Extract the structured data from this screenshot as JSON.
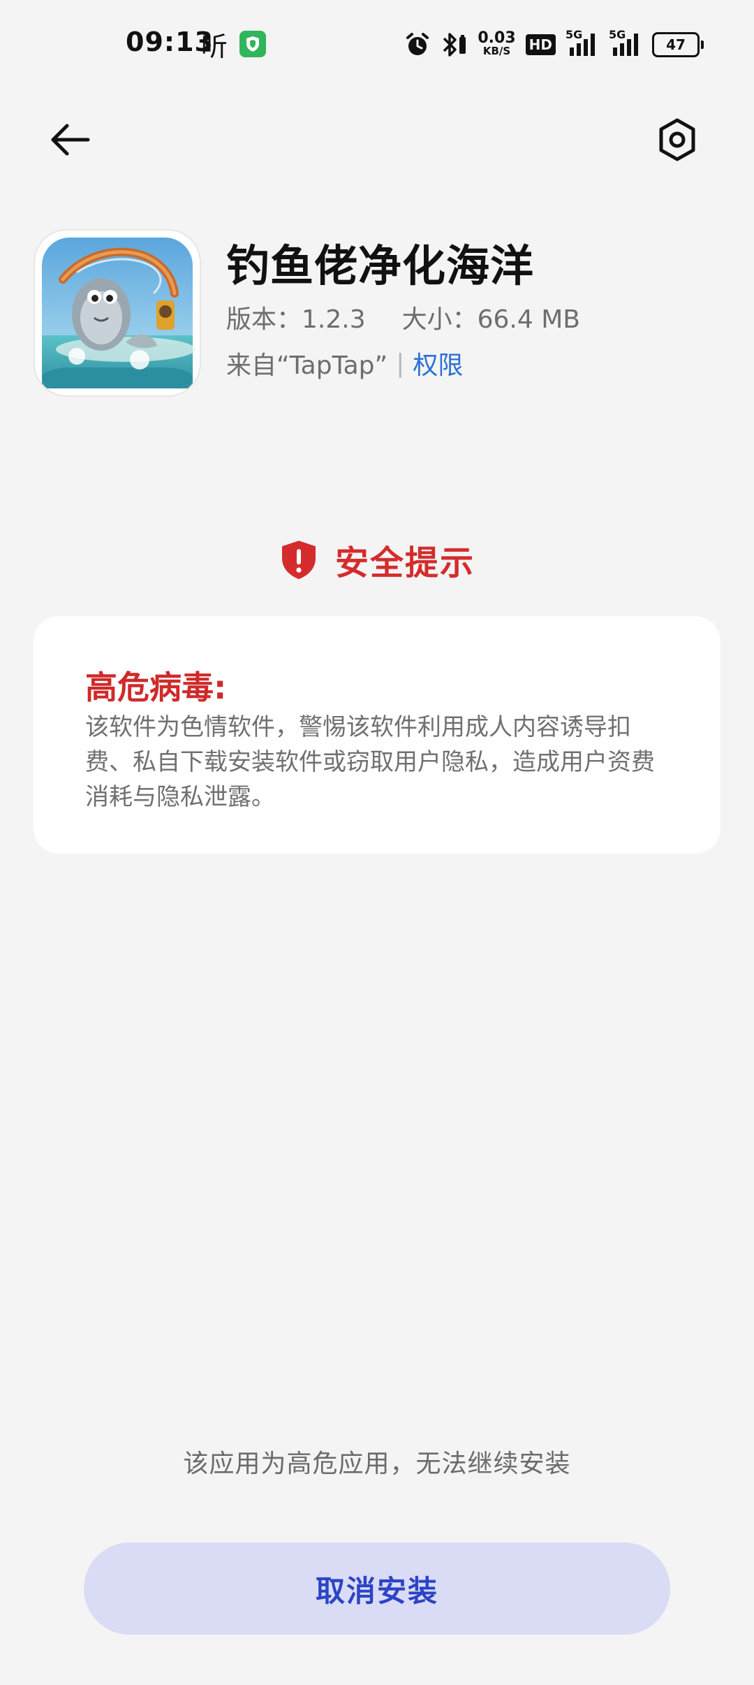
{
  "status_bar": {
    "time": "09:13",
    "ting_icon": "ting-listen-icon",
    "shield_app_icon": "green-shield-icon",
    "net_speed_value": "0.03",
    "net_speed_unit": "KB/S",
    "hd_label": "HD",
    "network_1": "5G",
    "network_2": "5G",
    "battery_level": "47"
  },
  "header": {
    "back_icon": "back-arrow-icon",
    "settings_icon": "settings-hexagon-icon"
  },
  "app": {
    "name": "钓鱼佬净化海洋",
    "version": "版本：1.2.3",
    "size": "大小：66.4 MB",
    "source": "来自“TapTap”",
    "separator": "|",
    "permissions_link": "权限"
  },
  "security": {
    "title": "安全提示",
    "icon": "red-shield-alert-icon",
    "warning_heading": "高危病毒:",
    "warning_body": "该软件为色情软件，警惕该软件利用成人内容诱导扣费、私自下载安装软件或窃取用户隐私，造成用户资费消耗与隐私泄露。"
  },
  "footer": {
    "notice": "该应用为高危应用，无法继续安装",
    "cancel_button": "取消安装"
  },
  "colors": {
    "danger": "#d42c2c",
    "link": "#2b70d6",
    "button_bg": "#d9dcf4",
    "button_text": "#2c44c4"
  }
}
